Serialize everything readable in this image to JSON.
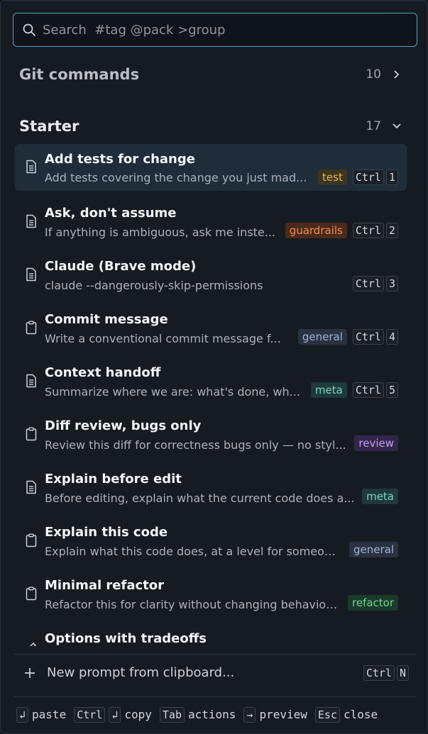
{
  "search": {
    "placeholder": "Search  #tag @pack >group",
    "value": ""
  },
  "groups": [
    {
      "title": "Git commands",
      "count": "10",
      "expanded": false
    },
    {
      "title": "Starter",
      "count": "17",
      "expanded": true
    }
  ],
  "items": [
    {
      "title": "Add tests for change",
      "desc": "Add tests covering the change you just mad...",
      "tag": "test",
      "tag_class": "test",
      "icon": "document-icon",
      "shortcut": [
        "Ctrl",
        "1"
      ],
      "selected": true
    },
    {
      "title": "Ask, don't assume",
      "desc": "If anything is ambiguous, ask me inste...",
      "tag": "guardrails",
      "tag_class": "guardrails",
      "icon": "document-icon",
      "shortcut": [
        "Ctrl",
        "2"
      ]
    },
    {
      "title": "Claude (Brave mode)",
      "desc": "claude --dangerously-skip-permissions",
      "tag": "",
      "tag_class": "",
      "icon": "document-icon",
      "shortcut": [
        "Ctrl",
        "3"
      ]
    },
    {
      "title": "Commit message",
      "desc": "Write a conventional commit message f...",
      "tag": "general",
      "tag_class": "general",
      "icon": "clipboard-icon",
      "shortcut": [
        "Ctrl",
        "4"
      ]
    },
    {
      "title": "Context handoff",
      "desc": "Summarize where we are: what's done, wh...",
      "tag": "meta",
      "tag_class": "meta",
      "icon": "document-icon",
      "shortcut": [
        "Ctrl",
        "5"
      ]
    },
    {
      "title": "Diff review, bugs only",
      "desc": "Review this diff for correctness bugs only — no styl...",
      "tag": "review",
      "tag_class": "review",
      "icon": "clipboard-icon",
      "shortcut": []
    },
    {
      "title": "Explain before edit",
      "desc": "Before editing, explain what the current code does a...",
      "tag": "meta",
      "tag_class": "meta",
      "icon": "document-icon",
      "shortcut": []
    },
    {
      "title": "Explain this code",
      "desc": "Explain what this code does, at a level for someon...",
      "tag": "general",
      "tag_class": "general",
      "icon": "clipboard-icon",
      "shortcut": []
    },
    {
      "title": "Minimal refactor",
      "desc": "Refactor this for clarity without changing behavior....",
      "tag": "refactor",
      "tag_class": "refactor",
      "icon": "clipboard-icon",
      "shortcut": []
    },
    {
      "title": "Options with tradeoffs",
      "desc": "",
      "tag": "",
      "tag_class": "",
      "icon": "pen-icon",
      "shortcut": []
    }
  ],
  "footer": {
    "new_prompt_label": "New prompt from clipboard...",
    "new_prompt_shortcut": [
      "Ctrl",
      "N"
    ]
  },
  "hints": [
    {
      "keys": [
        "↲"
      ],
      "label": "paste"
    },
    {
      "keys": [
        "Ctrl",
        "↲"
      ],
      "label": "copy"
    },
    {
      "keys": [
        "Tab"
      ],
      "label": "actions"
    },
    {
      "keys": [
        "→"
      ],
      "label": "preview"
    },
    {
      "keys": [
        "Esc"
      ],
      "label": "close"
    }
  ],
  "colors": {
    "accent": "#4fa6c9",
    "panel": "#161b22",
    "selected": "#1f2d3a"
  }
}
